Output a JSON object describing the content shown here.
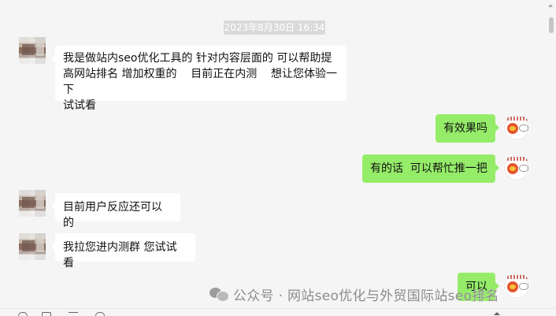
{
  "chat": {
    "timestamp": "2023年8月30日 16:34",
    "messages": [
      {
        "side": "left",
        "text": "我是做站内seo优化工具的 针对内容层面的 可以帮助提\n高网站排名 增加权重的    目前正在内测    想让您体验一下\n试试看"
      },
      {
        "side": "right",
        "text": "有效果吗"
      },
      {
        "side": "right",
        "text": "有的话  可以帮忙推一把"
      },
      {
        "side": "left",
        "text": "目前用户反应还可以的"
      },
      {
        "side": "left",
        "text": "我拉您进内测群 您试试看"
      },
      {
        "side": "right",
        "text": "可以"
      }
    ]
  },
  "watermark": {
    "text": "公众号 · 网站seo优化与外贸国际站seo排名"
  },
  "icons": {
    "scroll_up": "chevron-up-icon",
    "watermark_logo": "wechat-icon",
    "toolbar": [
      "emoji-icon",
      "folder-icon",
      "scissors-icon",
      "chat-history-icon",
      "chevron-up-icon"
    ]
  },
  "colors": {
    "background": "#f5f5f5",
    "incoming_bubble": "#ffffff",
    "outgoing_bubble": "#95ec69",
    "timestamp_bg": "#dadada"
  }
}
